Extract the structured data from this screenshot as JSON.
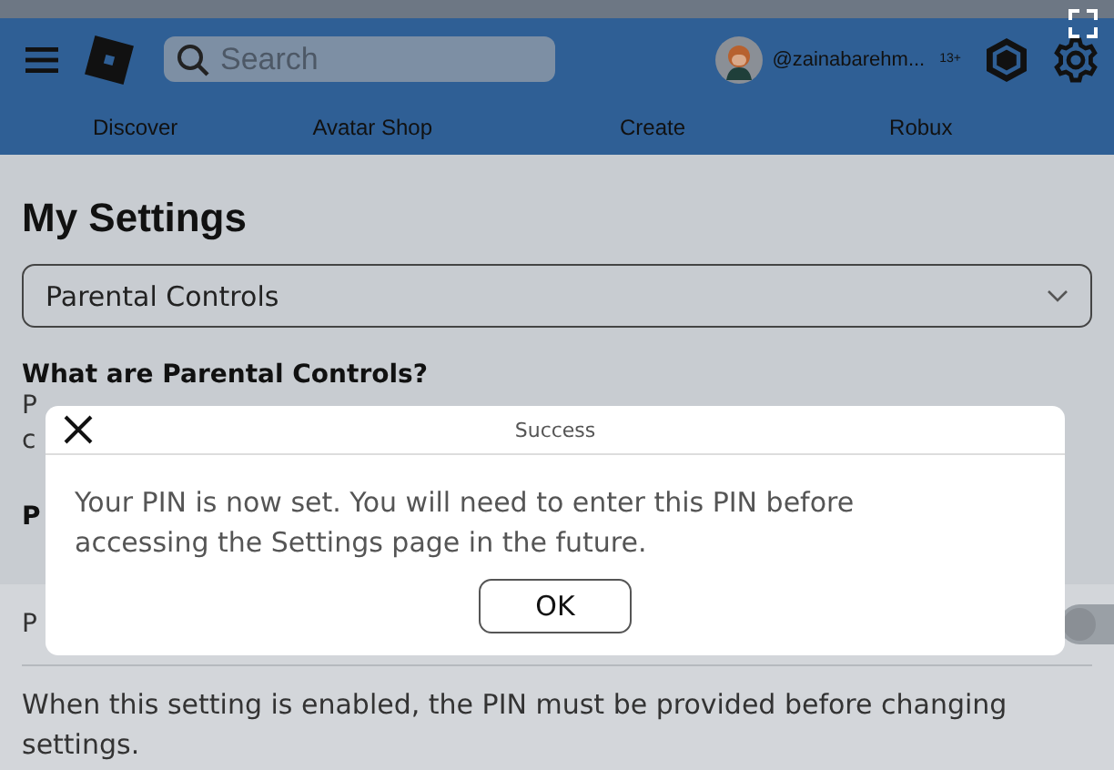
{
  "header": {
    "search": {
      "placeholder": "Search"
    },
    "username": "@zainabarehm...",
    "age_badge": "13+",
    "nav": [
      "Discover",
      "Avatar Shop",
      "Create",
      "Robux"
    ]
  },
  "page": {
    "title": "My Settings",
    "dropdown": {
      "value": "Parental Controls"
    },
    "section_heading": "What are Parental Controls?",
    "covered_texts": [
      {
        "kind": "plain",
        "text": "P"
      },
      {
        "kind": "plain",
        "text": "c"
      },
      {
        "kind": "bold",
        "text": "P"
      }
    ],
    "setting_row": {
      "label": "P",
      "on": false
    },
    "setting_description": "When this setting is enabled, the PIN must be provided before changing settings."
  },
  "dialog": {
    "title": "Success",
    "message": "Your PIN is now set. You will need to enter this PIN before accessing the Settings page in the future.",
    "button": "OK"
  }
}
